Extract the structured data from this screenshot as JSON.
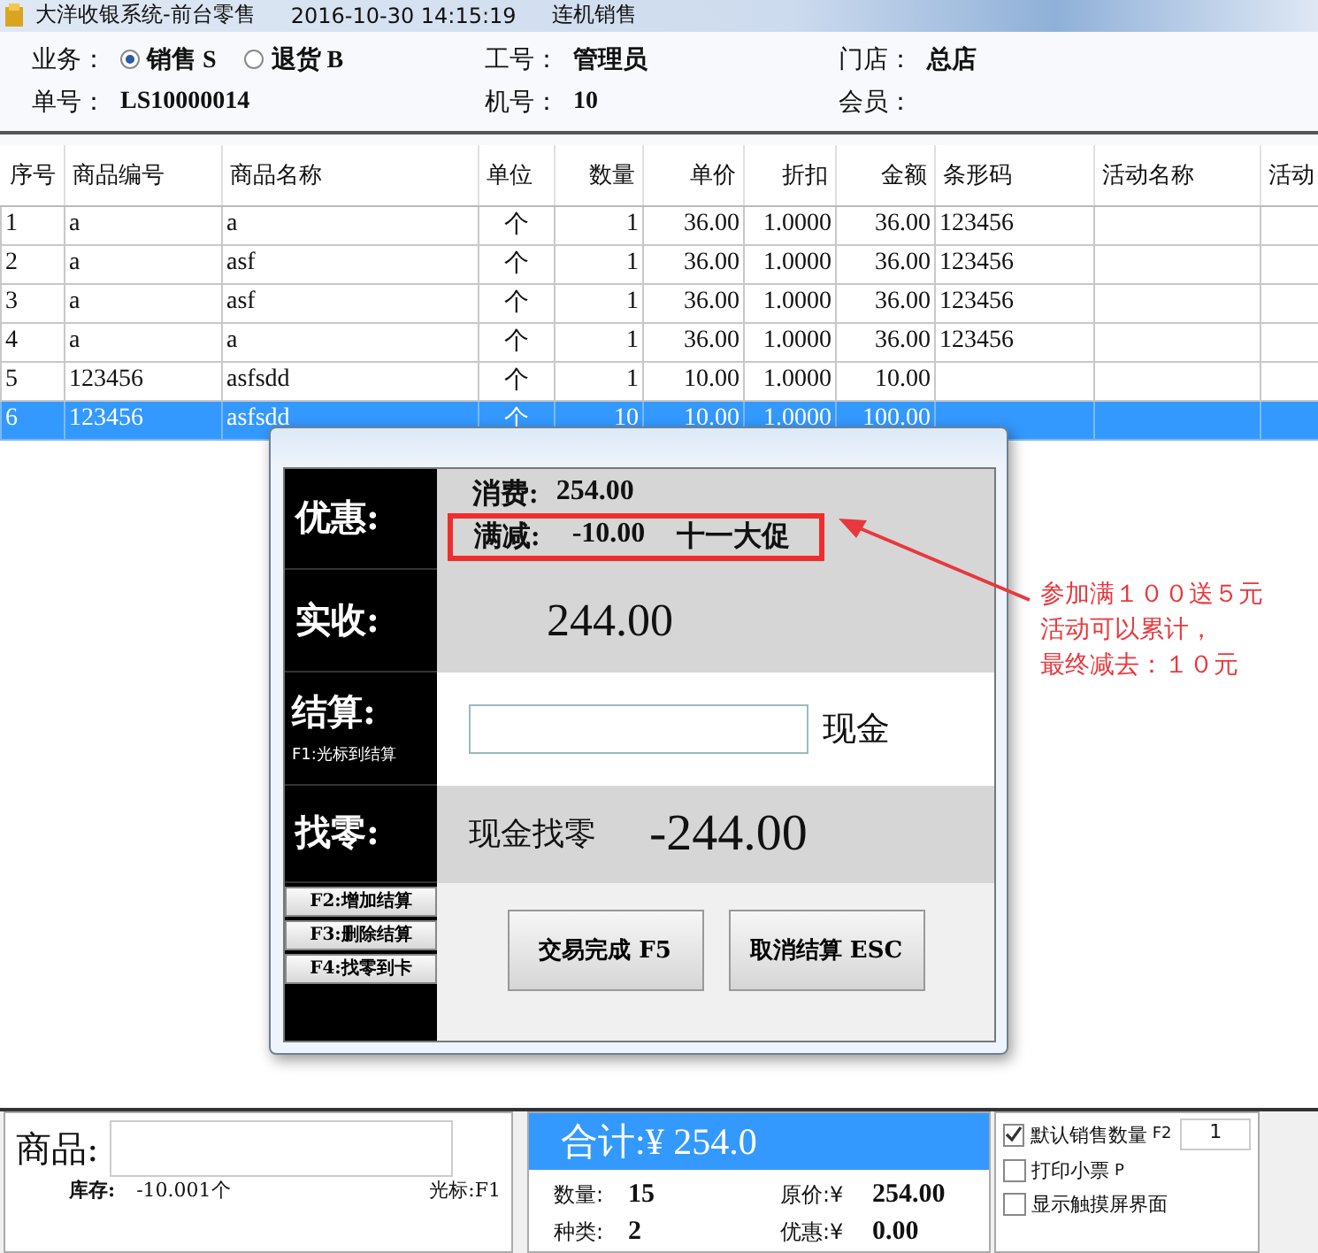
{
  "window": {
    "title": "大洋收银系统-前台零售",
    "datetime": "2016-10-30 14:15:19",
    "mode": "连机销售"
  },
  "header": {
    "business": {
      "label": "业务：",
      "options": [
        {
          "label": "销售 S",
          "selected": true
        },
        {
          "label": "退货 B",
          "selected": false
        }
      ]
    },
    "staff": {
      "label": "工号：",
      "value": "管理员"
    },
    "store": {
      "label": "门店：",
      "value": "总店"
    },
    "order_no": {
      "label": "单号：",
      "value": "LS10000014"
    },
    "machine": {
      "label": "机号：",
      "value": "10"
    },
    "member": {
      "label": "会员："
    }
  },
  "table": {
    "columns": [
      "序号",
      "商品编号",
      "商品名称",
      "单位",
      "数量",
      "单价",
      "折扣",
      "金额",
      "条形码",
      "活动名称",
      "活动"
    ],
    "rows": [
      {
        "cells": [
          "1",
          "a",
          "a",
          "个",
          "1",
          "36.00",
          "1.0000",
          "36.00",
          "123456",
          "",
          ""
        ],
        "selected": false
      },
      {
        "cells": [
          "2",
          "a",
          "asf",
          "个",
          "1",
          "36.00",
          "1.0000",
          "36.00",
          "123456",
          "",
          ""
        ],
        "selected": false
      },
      {
        "cells": [
          "3",
          "a",
          "asf",
          "个",
          "1",
          "36.00",
          "1.0000",
          "36.00",
          "123456",
          "",
          ""
        ],
        "selected": false
      },
      {
        "cells": [
          "4",
          "a",
          "a",
          "个",
          "1",
          "36.00",
          "1.0000",
          "36.00",
          "123456",
          "",
          ""
        ],
        "selected": false
      },
      {
        "cells": [
          "5",
          "123456",
          "asfsdd",
          "个",
          "1",
          "10.00",
          "1.0000",
          "10.00",
          "",
          "",
          ""
        ],
        "selected": false
      },
      {
        "cells": [
          "6",
          "123456",
          "asfsdd",
          "个",
          "10",
          "10.00",
          "1.0000",
          "100.00",
          "",
          "",
          ""
        ],
        "selected": true
      }
    ]
  },
  "dialog": {
    "discount": {
      "label": "优惠:",
      "spend_label": "消费:",
      "spend": "254.00",
      "reduction_label": "满减:",
      "reduction": "-10.00",
      "promotion": "十一大促"
    },
    "received": {
      "label": "实收:",
      "value": "244.00"
    },
    "settle": {
      "label": "结算:",
      "hint": "F1:光标到结算",
      "method": "现金"
    },
    "change": {
      "label": "找零:",
      "text": "现金找零",
      "value": "-244.00"
    },
    "side_buttons": [
      "F2:增加结算",
      "F3:删除结算",
      "F4:找零到卡"
    ],
    "buttons": [
      "交易完成 F5",
      "取消结算 ESC"
    ]
  },
  "annotation": {
    "lines": [
      "参加满１００送５元",
      "活动可以累计，",
      "最终减去：１０元"
    ]
  },
  "bottom": {
    "product": {
      "label": "商品:",
      "stock_label": "库存:",
      "stock": "-10.001个",
      "cursor_hint": "光标:F1"
    },
    "total": {
      "label": "合计:¥ 254.0",
      "quantity_label": "数量:",
      "quantity": "15",
      "original_label": "原价:¥",
      "original": "254.00",
      "kinds_label": "种类:",
      "kinds": "2",
      "discount_label": "优惠:¥",
      "discount": "0.00"
    },
    "options": [
      {
        "label": "默认销售数量",
        "key": "F2",
        "checked": true,
        "value": "1"
      },
      {
        "label": "打印小票",
        "key": "P",
        "checked": false
      },
      {
        "label": "显示触摸屏界面",
        "checked": false
      }
    ]
  }
}
